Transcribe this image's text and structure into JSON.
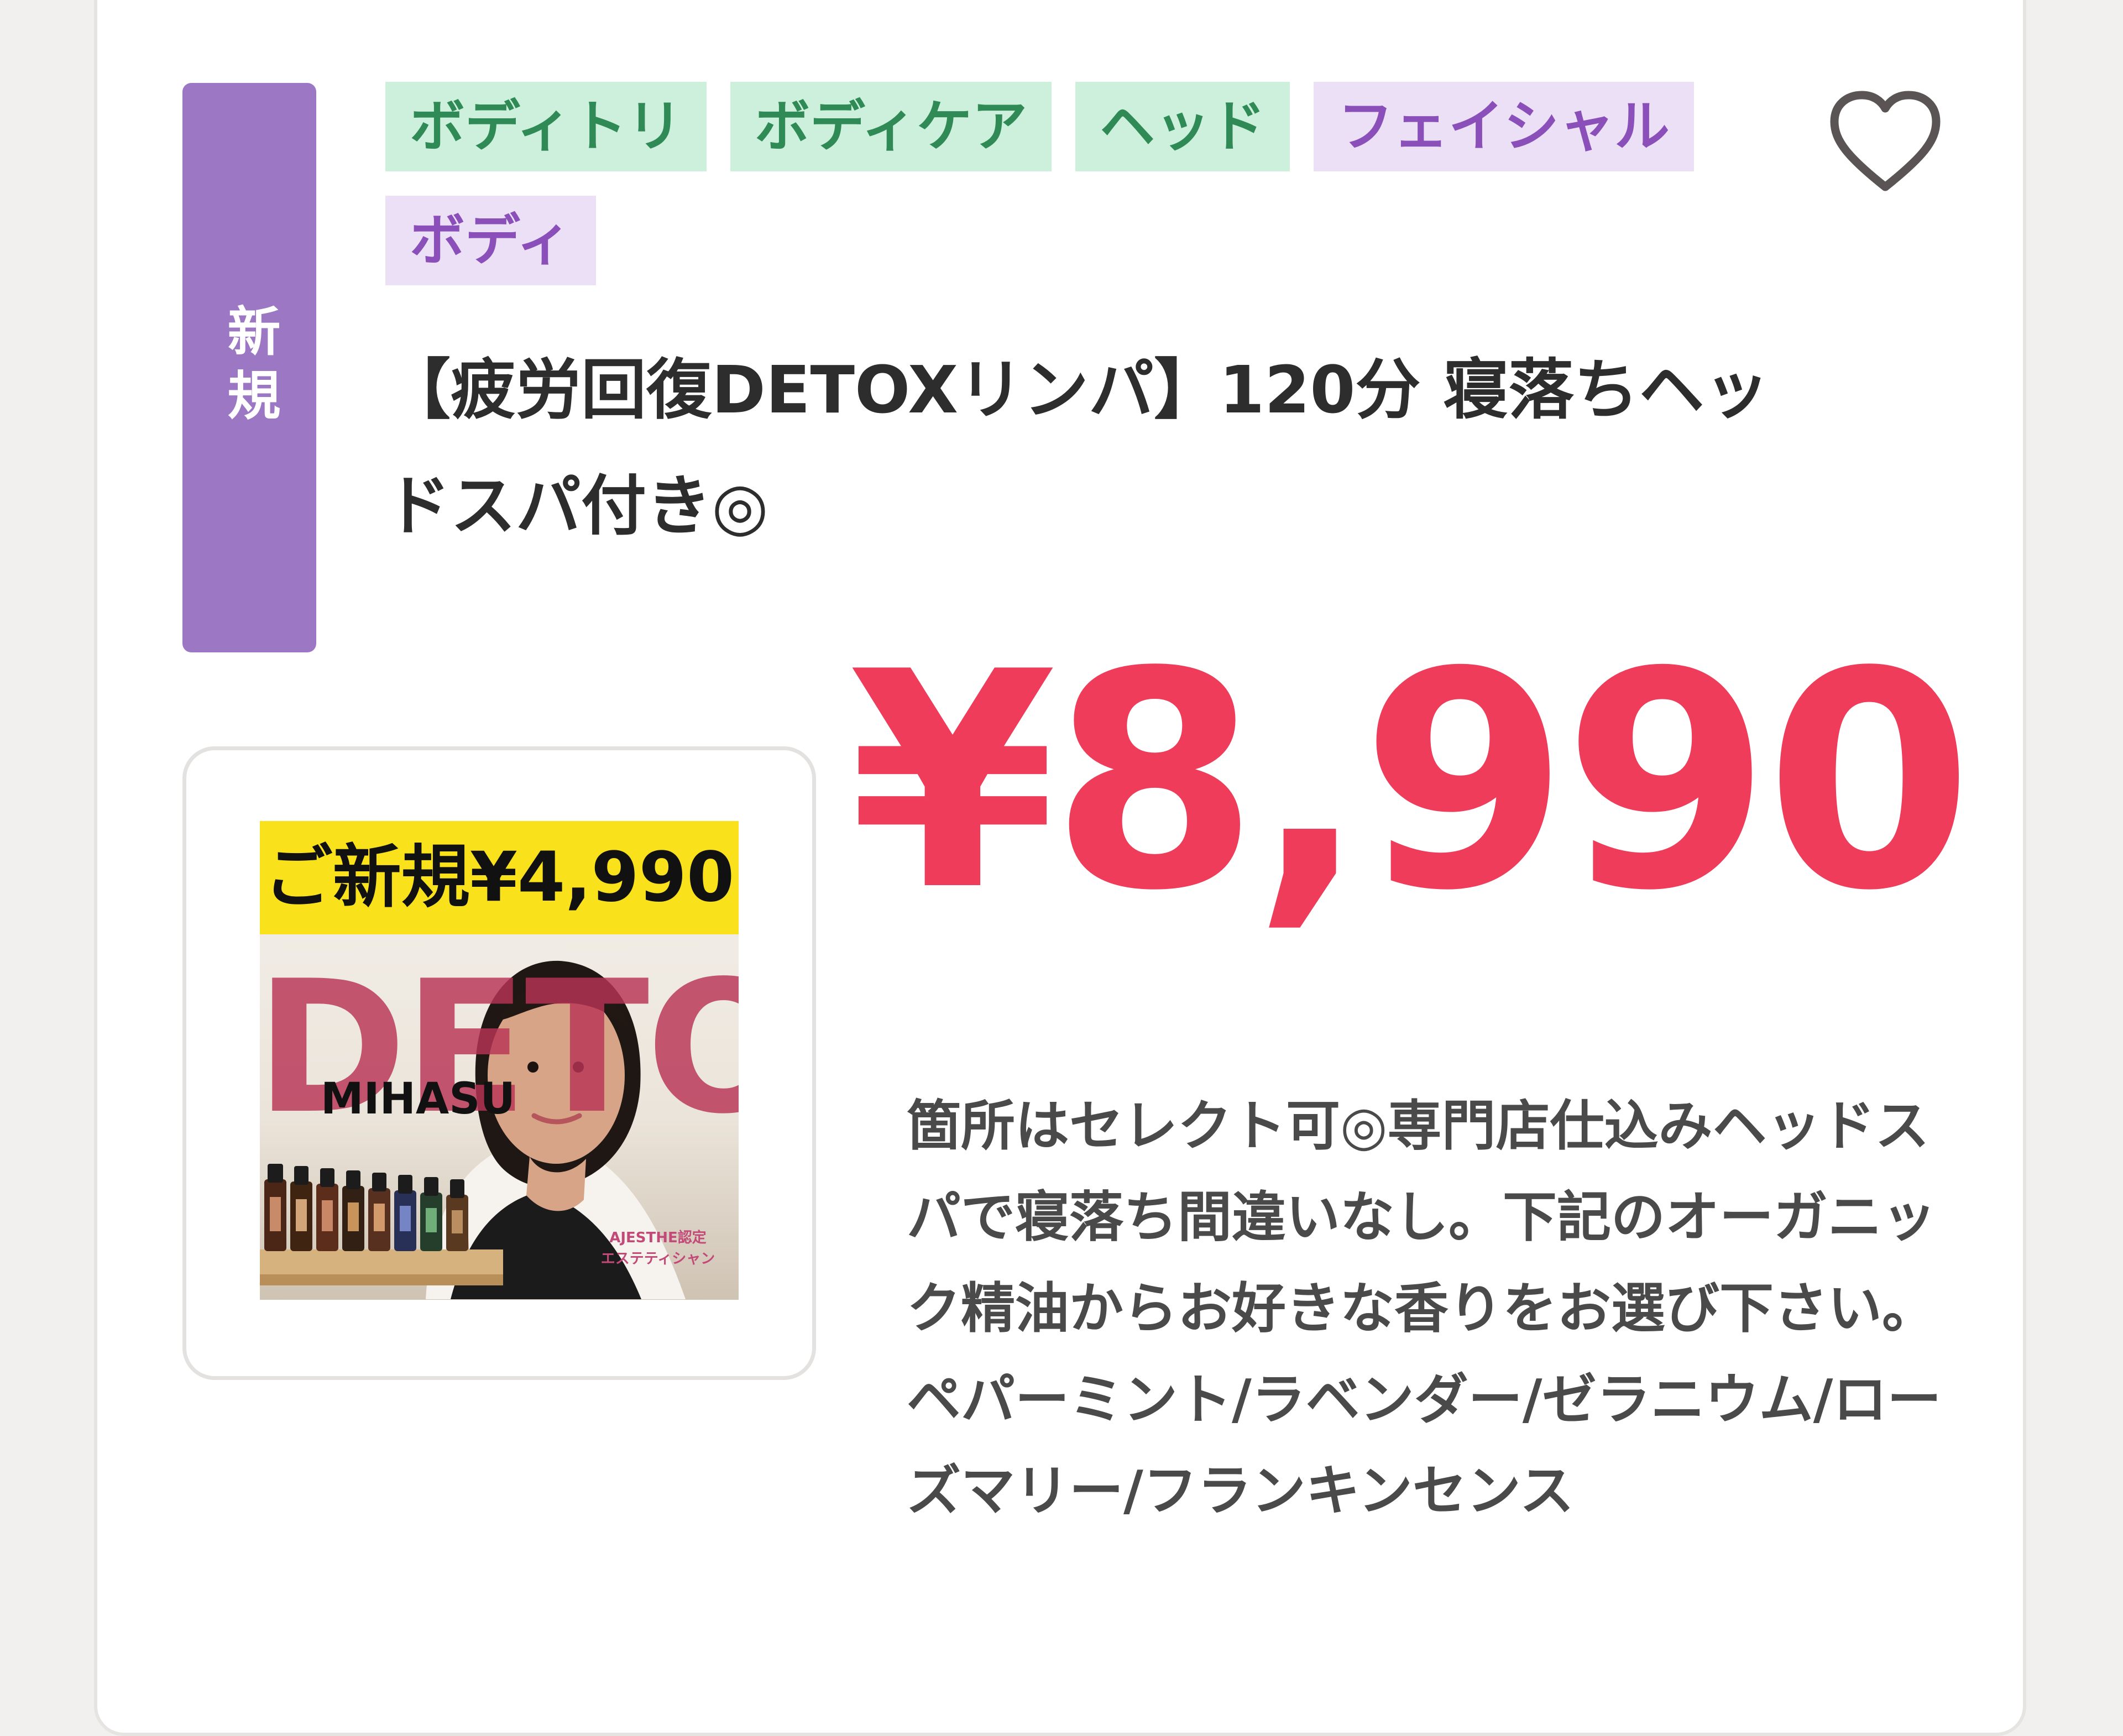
{
  "badge": {
    "label": "新規",
    "color": "#9b77c4"
  },
  "tags": [
    {
      "label": "ボディトリ",
      "color": "#2f8a55"
    },
    {
      "label": "ボディケア",
      "color": "#2f8a55"
    },
    {
      "label": "ヘッド",
      "color": "#2f8a55"
    },
    {
      "label": "フェイシャル",
      "color": "#8a4fb9"
    },
    {
      "label": "ボディ",
      "color": "#8a4fb9"
    }
  ],
  "favorite": {
    "icon": "heart-icon"
  },
  "title": "【疲労回復DETOXリンパ】120分 寝落ちヘッドスパ付き◎",
  "price": "¥8,990",
  "price_color": "#ee3c5a",
  "thumbnail": {
    "banner": "ご新規¥4,990",
    "headline": "DETOX",
    "name": "MIHASU",
    "caption": "AJESTHE認定\nエステティシャン"
  },
  "description": "箇所はセレクト可◎専門店仕込みヘッドスパで寝落ち間違いなし。下記のオーガニック精油からお好きな香りをお選び下さい。ペパーミント/ラベンダー/ゼラニウム/ローズマリー/フランキンセンス"
}
